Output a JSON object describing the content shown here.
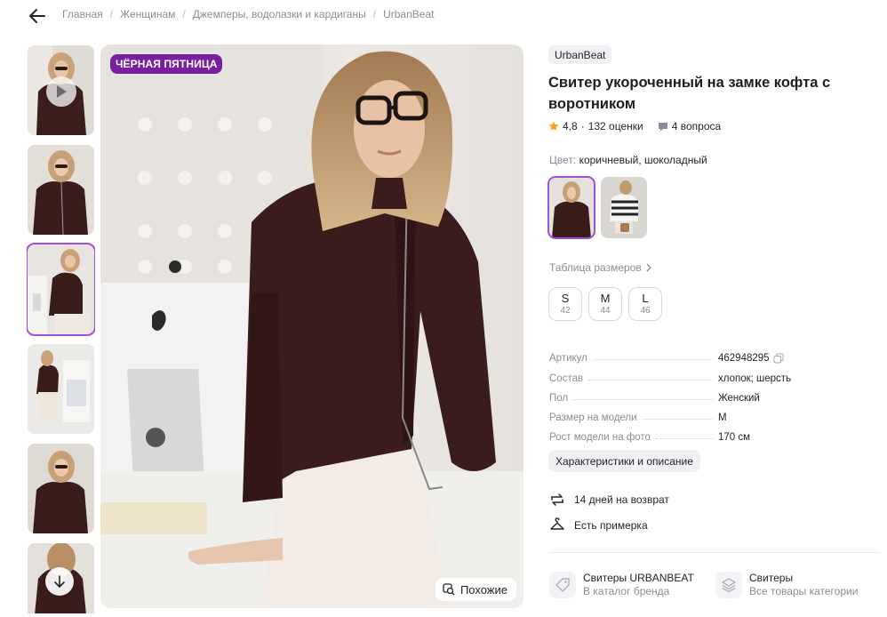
{
  "breadcrumbs": [
    "Главная",
    "Женщинам",
    "Джемперы, водолазки и кардиганы",
    "UrbanBeat"
  ],
  "gallery": {
    "badge": "ЧЁРНАЯ ПЯТНИЦА",
    "similar_label": "Похожие",
    "thumbnails": 6,
    "active_thumbnail": 3
  },
  "product": {
    "brand": "UrbanBeat",
    "title": "Свитер укороченный на замке кофта с воротником",
    "rating": "4,8",
    "reviews": "132 оценки",
    "questions": "4 вопроса",
    "color_label": "Цвет:",
    "color_value": "коричневый, шоколадный",
    "size_table": "Таблица размеров",
    "sizes": [
      {
        "size": "S",
        "ru": "42"
      },
      {
        "size": "M",
        "ru": "44"
      },
      {
        "size": "L",
        "ru": "46"
      }
    ],
    "specs": [
      {
        "key": "Артикул",
        "value": "462948295"
      },
      {
        "key": "Состав",
        "value": "хлопок; шерсть"
      },
      {
        "key": "Пол",
        "value": "Женский"
      },
      {
        "key": "Размер на модели",
        "value": "M"
      },
      {
        "key": "Рост модели на фото",
        "value": "170 см"
      }
    ],
    "characteristics_button": "Характеристики и описание",
    "features": [
      "14 дней на возврат",
      "Есть примерка"
    ],
    "category_links": [
      {
        "title": "Свитеры URBANBEAT",
        "subtitle": "В каталог бренда"
      },
      {
        "title": "Свитеры",
        "subtitle": "Все товары категории"
      }
    ]
  },
  "colors": {
    "accent": "#a14fdc",
    "badge": "#7a1fa2",
    "star": "#ff9f1a",
    "muted": "#8b8b99"
  }
}
